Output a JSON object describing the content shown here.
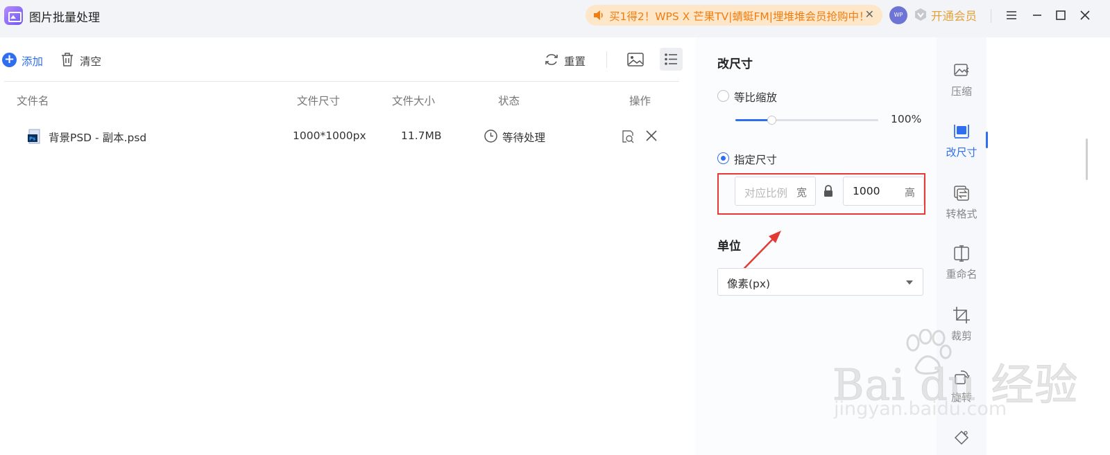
{
  "app": {
    "title": "图片批量处理",
    "promo_text": "买1得2！WPS X 芒果TV|蜻蜓FM|埋堆堆会员抢购中！",
    "avatar_text": "WP",
    "vip_label": "开通会员"
  },
  "toolbar": {
    "add_label": "添加",
    "clear_label": "清空",
    "reset_label": "重置"
  },
  "table": {
    "headers": [
      "文件名",
      "文件尺寸",
      "文件大小",
      "状态",
      "操作"
    ],
    "rows": [
      {
        "name": "背景PSD - 副本.psd",
        "dimensions": "1000*1000px",
        "size": "11.7MB",
        "status": "等待处理"
      }
    ]
  },
  "resize_panel": {
    "title": "改尺寸",
    "option_scale": "等比缩放",
    "scale_percent": 100,
    "scale_value": "100%",
    "option_fixed": "指定尺寸",
    "width_placeholder": "对应比例",
    "width_unit": "宽",
    "height_value": "1000",
    "height_unit": "高",
    "unit_title": "单位",
    "unit_selected": "像素(px)"
  },
  "side_nav": {
    "items": [
      {
        "label": "压缩",
        "icon": "compress-icon"
      },
      {
        "label": "改尺寸",
        "icon": "resize-icon"
      },
      {
        "label": "转格式",
        "icon": "convert-icon"
      },
      {
        "label": "重命名",
        "icon": "rename-icon"
      },
      {
        "label": "裁剪",
        "icon": "crop-icon"
      },
      {
        "label": "旋转",
        "icon": "rotate-icon"
      }
    ]
  },
  "watermark": {
    "brand": "Bai du 经验",
    "url": "jingyan.baidu.com"
  },
  "colors": {
    "accent": "#2f6ef0",
    "promo_text": "#f07d12",
    "highlight_box": "#e23b36"
  }
}
